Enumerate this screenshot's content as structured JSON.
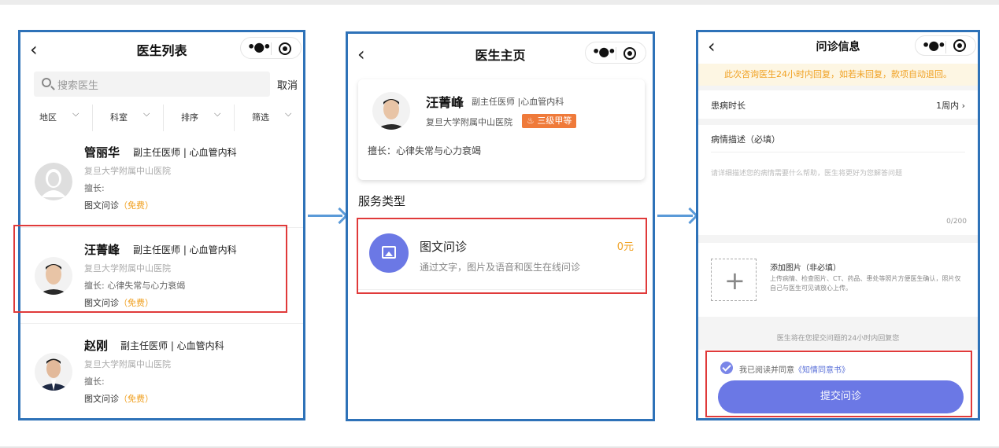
{
  "panel1": {
    "nav_title": "医生列表",
    "back_icon": "chevron-left-icon",
    "search_placeholder": "搜索医生",
    "cancel": "取消",
    "filters": [
      "地区",
      "科室",
      "排序",
      "筛选"
    ],
    "doctors": [
      {
        "name": "管丽华",
        "title": "副主任医师 | 心血管内科",
        "hospital": "复旦大学附属中山医院",
        "specialty": "擅长:",
        "service": "图文问诊",
        "free": "（免费）"
      },
      {
        "name": "汪菁峰",
        "title": "副主任医师 | 心血管内科",
        "hospital": "复旦大学附属中山医院",
        "specialty": "擅长: 心律失常与心力衰竭",
        "service": "图文问诊",
        "free": "（免费）"
      },
      {
        "name": "赵刚",
        "title": "副主任医师 | 心血管内科",
        "hospital": "复旦大学附属中山医院",
        "specialty": "擅长:",
        "service": "图文问诊",
        "free": "（免费）"
      }
    ]
  },
  "panel2": {
    "nav_title": "医生主页",
    "doctor": {
      "name": "汪菁峰",
      "title": "副主任医师 |心血管内科",
      "hospital": "复旦大学附属中山医院",
      "badge": "三级甲等",
      "specialty": "擅长：心律失常与心力衰竭"
    },
    "service_header": "服务类型",
    "service": {
      "label": "图文问诊",
      "description": "通过文字，图片及语音和医生在线问诊",
      "price": "0元"
    }
  },
  "panel3": {
    "nav_title": "问诊信息",
    "notice": "此次咨询医生24小时内回复，如若未回复，款项自动退回。",
    "duration_label": "患病时长",
    "duration_value": "1周内",
    "desc_label": "病情描述（必填）",
    "desc_placeholder": "请详细描述您的病情需要什么帮助，医生将更好为您解答问题",
    "counter": "0/200",
    "upload_title": "添加图片（非必填）",
    "upload_desc": "上传病情、检查图片、CT、药品、患处等照片方便医生确认，照片仅自己与医生可见请放心上传。",
    "reply_note": "医生将在您提交问题的24小时内回复您",
    "agree_text": "我已阅读并同意",
    "agree_link": "《知情同意书》",
    "submit": "提交问诊"
  },
  "colors": {
    "frame": "#2e72b8",
    "highlight": "#e03a3a",
    "accent": "#6b78e5",
    "price": "#f0a020",
    "arrow": "#5a9ad8"
  }
}
